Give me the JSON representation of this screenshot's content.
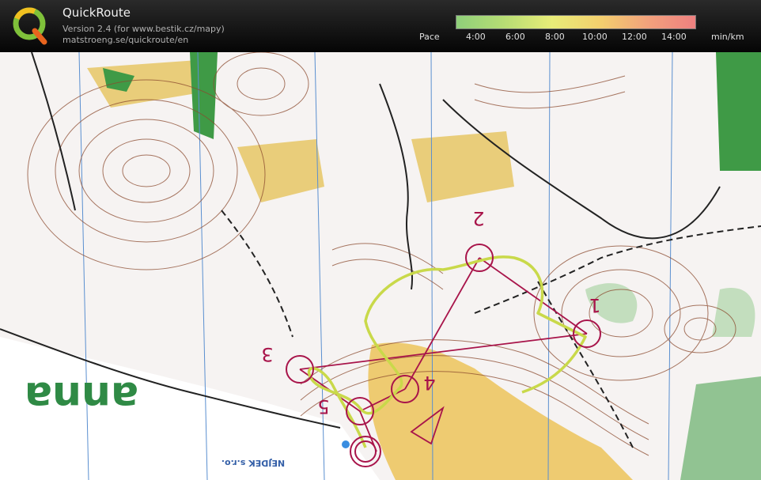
{
  "app": {
    "title": "QuickRoute",
    "version": "Version 2.4  (for www.bestik.cz/mapy)",
    "url": "matstroeng.se/quickroute/en"
  },
  "pace_legend": {
    "label": "Pace",
    "ticks": [
      "4:00",
      "6:00",
      "8:00",
      "10:00",
      "12:00",
      "14:00"
    ],
    "unit": "min/km",
    "colors": [
      "#8fcf7a",
      "#b7dd74",
      "#e8ec78",
      "#f3d06e",
      "#f2a27c",
      "#ee8080"
    ]
  },
  "map": {
    "controls": [
      {
        "number": "1"
      },
      {
        "number": "2"
      },
      {
        "number": "3"
      },
      {
        "number": "4"
      },
      {
        "number": "5"
      }
    ],
    "print_text_big": "anna",
    "print_text_small": "NEJDEK s.r.o.",
    "colors": {
      "paper": "#f6f3f2",
      "yellow": "#ecc35a",
      "green": "#3f9a46",
      "contour": "#8b4a2e",
      "course": "#a8144a",
      "route": "#c9d94a"
    }
  }
}
